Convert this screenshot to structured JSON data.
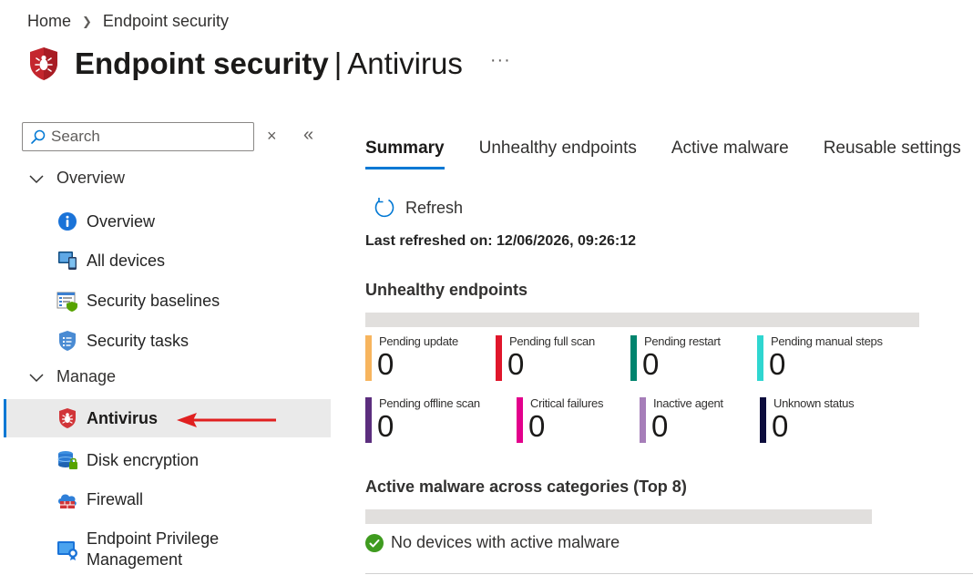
{
  "breadcrumb": {
    "home": "Home",
    "current": "Endpoint security"
  },
  "header": {
    "title_bold": "Endpoint security",
    "separator": "|",
    "title_sub": "Antivirus",
    "more": "···"
  },
  "sidebar": {
    "search_placeholder": "Search",
    "clear": "×",
    "collapse": "«",
    "groups": [
      {
        "label": "Overview"
      },
      {
        "label": "Manage"
      }
    ],
    "items": [
      {
        "label": "Overview",
        "icon": "info-icon"
      },
      {
        "label": "All devices",
        "icon": "devices-icon"
      },
      {
        "label": "Security baselines",
        "icon": "baselines-icon"
      },
      {
        "label": "Security tasks",
        "icon": "tasks-icon"
      },
      {
        "label": "Antivirus",
        "icon": "antivirus-shield-icon",
        "active": true
      },
      {
        "label": "Disk encryption",
        "icon": "disk-encryption-icon"
      },
      {
        "label": "Firewall",
        "icon": "firewall-icon"
      },
      {
        "label": "Endpoint Privilege",
        "label2": "Management",
        "icon": "privilege-management-icon"
      }
    ]
  },
  "tabs": [
    {
      "label": "Summary",
      "active": true
    },
    {
      "label": "Unhealthy endpoints"
    },
    {
      "label": "Active malware"
    },
    {
      "label": "Reusable settings"
    }
  ],
  "toolbar": {
    "refresh": "Refresh"
  },
  "last_refreshed": "Last refreshed on: 12/06/2026, 09:26:12",
  "unhealthy": {
    "title": "Unhealthy endpoints",
    "tiles": [
      {
        "label": "Pending update",
        "value": "0",
        "color": "#f7b55e"
      },
      {
        "label": "Pending full scan",
        "value": "0",
        "color": "#e0162b"
      },
      {
        "label": "Pending restart",
        "value": "0",
        "color": "#00846e"
      },
      {
        "label": "Pending manual steps",
        "value": "0",
        "color": "#2fd6d0"
      },
      {
        "label": "Pending offline scan",
        "value": "0",
        "color": "#5c2e7e"
      },
      {
        "label": "Critical failures",
        "value": "0",
        "color": "#e3008c"
      },
      {
        "label": "Inactive agent",
        "value": "0",
        "color": "#a67eb9"
      },
      {
        "label": "Unknown status",
        "value": "0",
        "color": "#0d0d3d"
      }
    ]
  },
  "malware": {
    "title": "Active malware across categories (Top 8)",
    "message": "No devices with active malware"
  },
  "colors": {
    "accent": "#0078d4",
    "arrow": "#e02020",
    "success": "#3f9b1f"
  }
}
